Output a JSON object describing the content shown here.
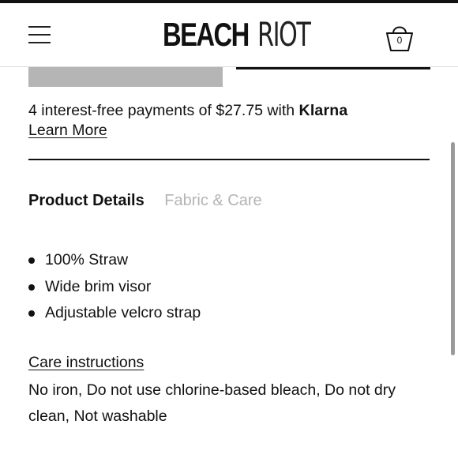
{
  "header": {
    "menu_icon": "hamburger-menu-icon",
    "logo_bold": "BEACH",
    "logo_thin": "RIOT",
    "cart_icon": "shopping-bag-icon",
    "cart_count": "0"
  },
  "payment": {
    "text": "4 interest-free payments of $27.75 with ",
    "provider": "Klarna",
    "learn_more": "Learn More"
  },
  "tabs": [
    {
      "label": "Product Details",
      "active": true
    },
    {
      "label": "Fabric & Care",
      "active": false
    }
  ],
  "details": {
    "bullets": [
      "100% Straw",
      "Wide brim visor",
      "Adjustable velcro strap"
    ]
  },
  "care": {
    "title": "Care instructions",
    "text": "No iron, Do not use chlorine-based bleach, Do not dry clean, Not washable"
  },
  "colors": {
    "text": "#111111",
    "inactive_tab": "#b4b4b4",
    "placeholder_block": "#b5b5b5",
    "background": "#ffffff"
  }
}
